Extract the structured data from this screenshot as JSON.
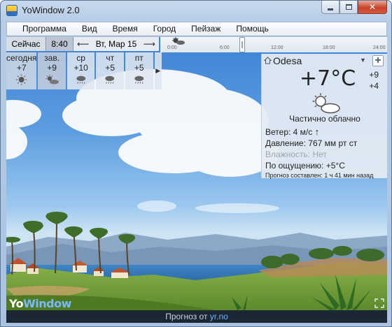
{
  "window": {
    "title": "YoWindow 2.0",
    "minimize_symbol": "minimize",
    "maximize_symbol": "maximize",
    "close_symbol": "✕"
  },
  "menu": [
    "Программа",
    "Вид",
    "Время",
    "Город",
    "Пейзаж",
    "Помощь"
  ],
  "time_strip": {
    "now_label": "Сейчас",
    "time": "8:40",
    "date": "Вт, Мар 15",
    "prev_icon": "arrow-left-icon",
    "next_icon": "arrow-right-icon",
    "ticks": [
      "0:00",
      "6:00",
      "12:00",
      "18:00",
      "24:00"
    ]
  },
  "forecast": [
    {
      "day": "сегодня",
      "temp": "+7",
      "icon": "sun-icon"
    },
    {
      "day": "зав.",
      "temp": "+9",
      "icon": "partly-cloudy-icon"
    },
    {
      "day": "ср",
      "temp": "+10",
      "icon": "cloud-rain-icon"
    },
    {
      "day": "чт",
      "temp": "+5",
      "icon": "cloud-rain-icon"
    },
    {
      "day": "пт",
      "temp": "+5",
      "icon": "cloud-rain-icon"
    }
  ],
  "current": {
    "city": "Odesa",
    "temp": "+7°C",
    "high": "+9",
    "low": "+4",
    "condition": "Частично облачно",
    "wind_label": "Ветер:",
    "wind_value": "4 м/с",
    "pressure_label": "Давление:",
    "pressure_value": "767 мм рт ст",
    "humidity_label": "Влажность:",
    "humidity_value": "Нет",
    "feels_label": "По ощущению:",
    "feels_value": "+5°C",
    "forecast_made_label": "Прогноз составлен:",
    "forecast_made_value": "1 ч 41 мин назад"
  },
  "logo": {
    "yo": "Yo",
    "w": "Window"
  },
  "status": {
    "prefix": "Прогноз от",
    "source": "yr.no"
  },
  "colors": {
    "sky_top": "#3d82d4",
    "sea": "#2e73b8",
    "grass": "#6f9a35",
    "status_bg": "#1c2735",
    "link": "#6fb3ff"
  }
}
